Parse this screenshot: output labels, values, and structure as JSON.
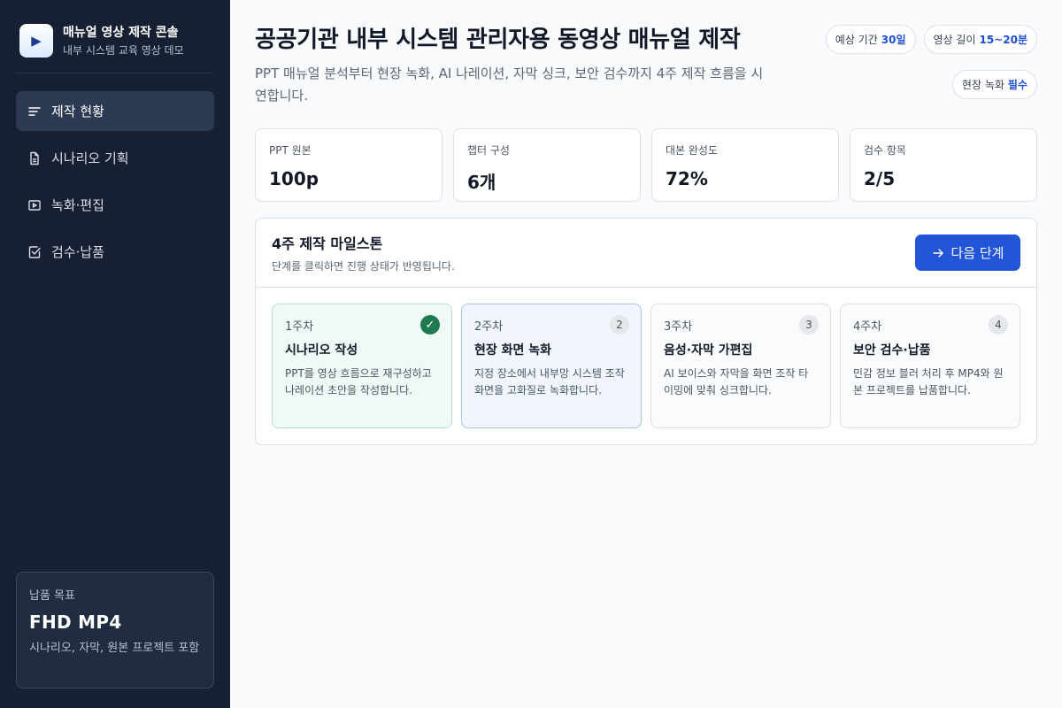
{
  "brand": {
    "logo_glyph": "▶",
    "title": "매뉴얼 영상 제작 콘솔",
    "subtitle": "내부 시스템 교육 영상 데모"
  },
  "nav": [
    {
      "label": "제작 현황",
      "icon": "list-icon",
      "active": true
    },
    {
      "label": "시나리오 기획",
      "icon": "document-icon",
      "active": false
    },
    {
      "label": "녹화·편집",
      "icon": "video-icon",
      "active": false
    },
    {
      "label": "검수·납품",
      "icon": "checkbox-icon",
      "active": false
    }
  ],
  "goal": {
    "label": "납품 목표",
    "value": "FHD MP4",
    "desc": "시나리오, 자막, 원본 프로젝트 포함"
  },
  "header": {
    "title": "공공기관 내부 시스템 관리자용 동영상 매뉴얼 제작",
    "desc": "PPT 매뉴얼 분석부터 현장 녹화, AI 나레이션, 자막 싱크, 보안 검수까지 4주 제작 흐름을 시연합니다."
  },
  "pills": [
    {
      "label": "예상 기간",
      "value": "30일"
    },
    {
      "label": "영상 길이",
      "value": "15~20분"
    },
    {
      "label": "현장 녹화",
      "value": "필수"
    }
  ],
  "stats": [
    {
      "label": "PPT 원본",
      "value": "100p"
    },
    {
      "label": "챕터 구성",
      "value": "6개"
    },
    {
      "label": "대본 완성도",
      "value": "72%"
    },
    {
      "label": "검수 항목",
      "value": "2/5"
    }
  ],
  "milestone": {
    "title": "4주 제작 마일스톤",
    "subtitle": "단계를 클릭하면 진행 상태가 반영됩니다.",
    "next_label": "다음 단계",
    "steps": [
      {
        "week": "1주차",
        "title": "시나리오 작성",
        "desc": "PPT를 영상 흐름으로 재구성하고 나레이션 초안을 작성합니다.",
        "badge": "✓",
        "state": "done"
      },
      {
        "week": "2주차",
        "title": "현장 화면 녹화",
        "desc": "지정 장소에서 내부망 시스템 조작 화면을 고화질로 녹화합니다.",
        "badge": "2",
        "state": "current"
      },
      {
        "week": "3주차",
        "title": "음성·자막 가편집",
        "desc": "AI 보이스와 자막을 화면 조작 타이밍에 맞춰 싱크합니다.",
        "badge": "3",
        "state": "pending"
      },
      {
        "week": "4주차",
        "title": "보안 검수·납품",
        "desc": "민감 정보 블러 처리 후 MP4와 원본 프로젝트를 납품합니다.",
        "badge": "4",
        "state": "pending"
      }
    ]
  },
  "colors": {
    "sidebar_bg": "#172033",
    "accent": "#2355d8",
    "done_green": "#1d7a52"
  }
}
